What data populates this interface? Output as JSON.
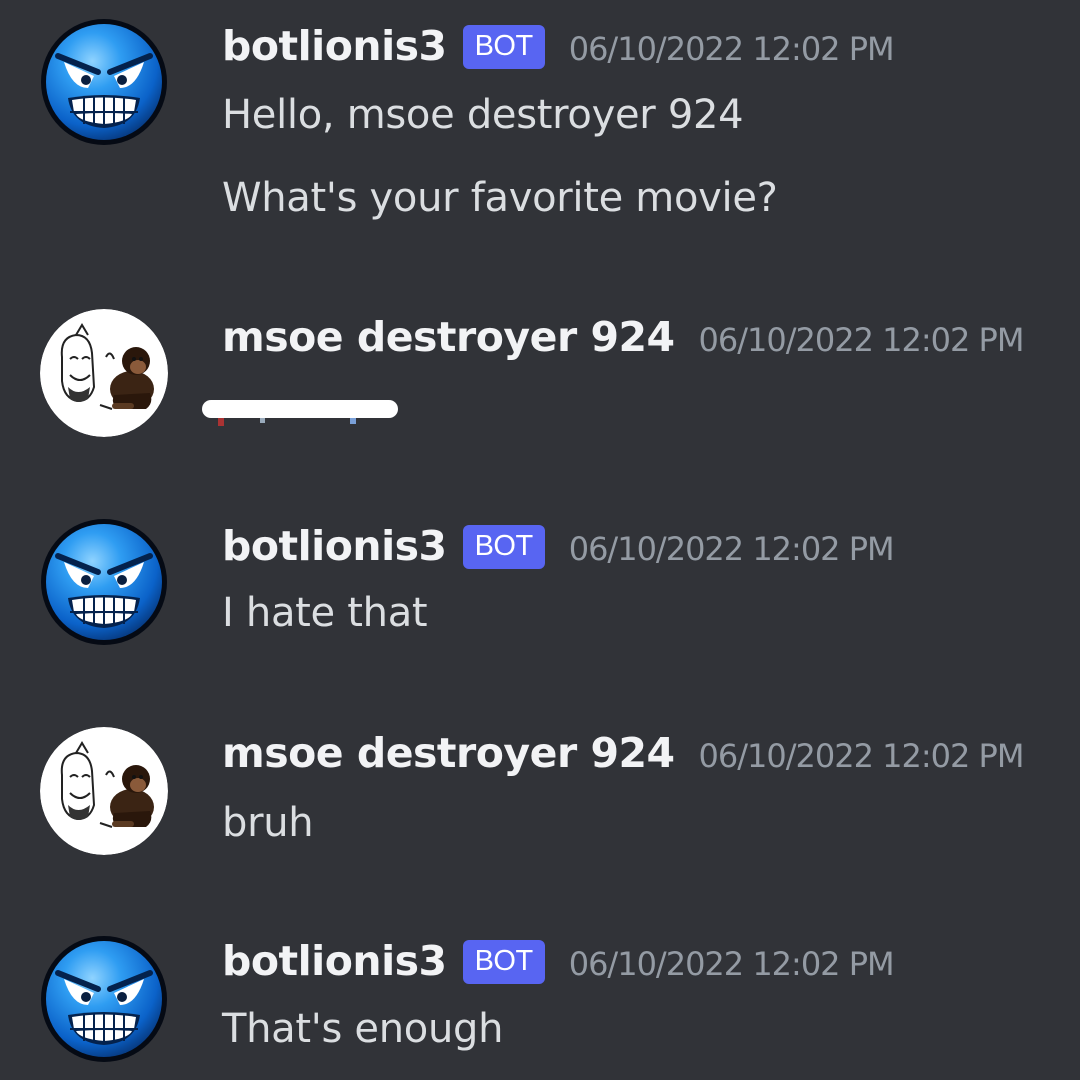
{
  "colors": {
    "background": "#313338",
    "username": "#f2f3f5",
    "message_text": "#dbdee1",
    "timestamp": "#949ba4",
    "bot_tag": "#5865f2"
  },
  "messages": [
    {
      "username": "botlionis3",
      "bot_tag": "BOT",
      "timestamp": "06/10/2022 12:02 PM",
      "avatar_icon": "blue-grinning-face-icon",
      "lines": [
        "Hello, msoe destroyer 924",
        "What's your favorite movie?"
      ]
    },
    {
      "username": "msoe destroyer 924",
      "timestamp": "06/10/2022 12:02 PM",
      "avatar_icon": "meme-drawing-and-chimpanzee-icon",
      "lines": []
    },
    {
      "username": "botlionis3",
      "bot_tag": "BOT",
      "timestamp": "06/10/2022 12:02 PM",
      "avatar_icon": "blue-grinning-face-icon",
      "lines": [
        "I hate that"
      ]
    },
    {
      "username": "msoe destroyer 924",
      "timestamp": "06/10/2022 12:02 PM",
      "avatar_icon": "meme-drawing-and-chimpanzee-icon",
      "lines": [
        "bruh"
      ]
    },
    {
      "username": "botlionis3",
      "bot_tag": "BOT",
      "timestamp": "06/10/2022 12:02 PM",
      "avatar_icon": "blue-grinning-face-icon",
      "lines": [
        "That's enough"
      ]
    }
  ]
}
